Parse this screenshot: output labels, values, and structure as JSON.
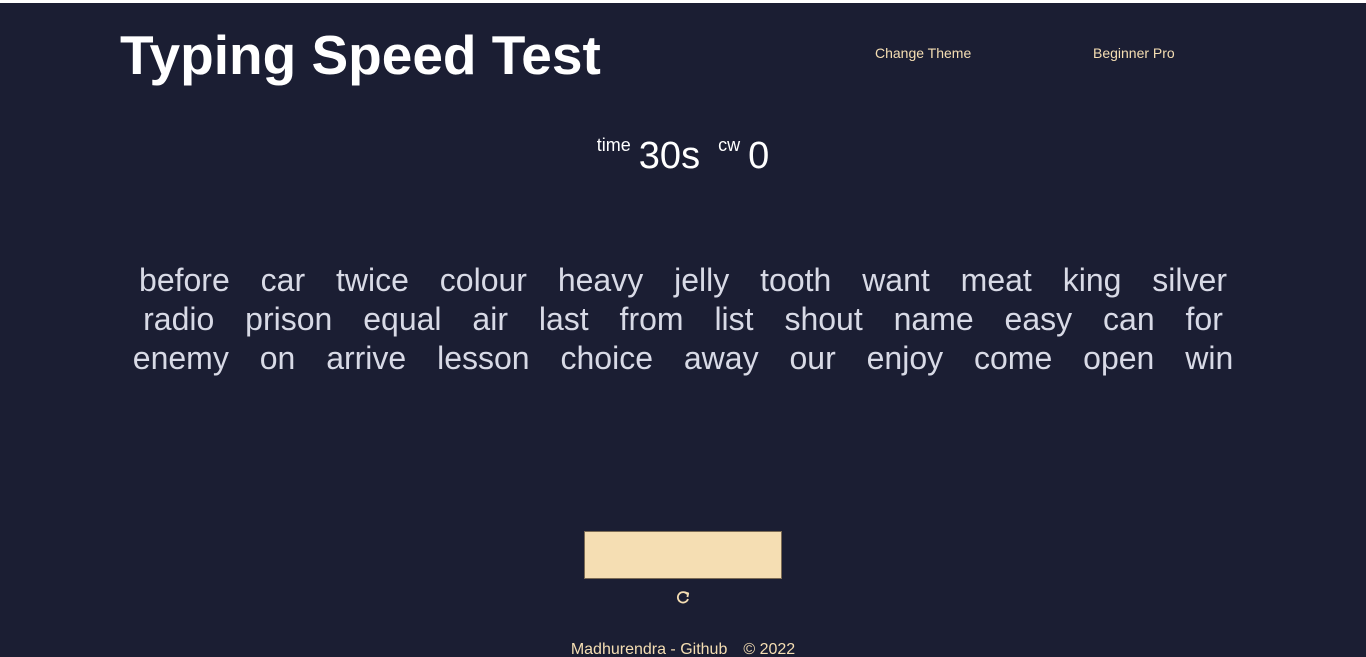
{
  "header": {
    "title": "Typing Speed Test",
    "change_theme_label": "Change Theme",
    "mode_label": "Beginner Pro"
  },
  "stats": {
    "time_label": "time",
    "time_value": "30s",
    "cw_label": "cw",
    "cw_value": "0"
  },
  "words": [
    "before",
    "car",
    "twice",
    "colour",
    "heavy",
    "jelly",
    "tooth",
    "want",
    "meat",
    "king",
    "silver",
    "radio",
    "prison",
    "equal",
    "air",
    "last",
    "from",
    "list",
    "shout",
    "name",
    "easy",
    "can",
    "for",
    "enemy",
    "on",
    "arrive",
    "lesson",
    "choice",
    "away",
    "our",
    "enjoy",
    "come",
    "open",
    "win"
  ],
  "input": {
    "value": "",
    "placeholder": ""
  },
  "restart_icon": "restart-icon",
  "footer": {
    "author_link": "Madhurendra - Github",
    "copyright": "© 2022"
  },
  "colors": {
    "background": "#1b1e33",
    "accent": "#f5deb3",
    "text": "#ffffff",
    "words": "#d8dae6"
  }
}
